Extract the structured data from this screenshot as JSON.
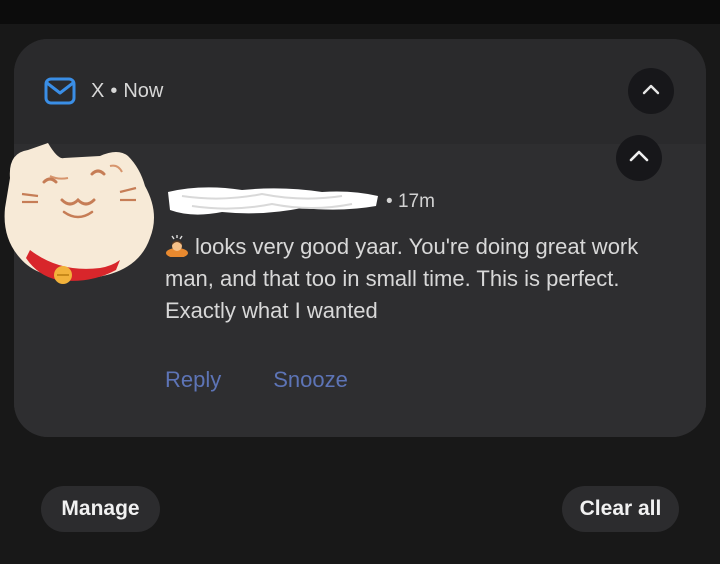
{
  "notification": {
    "app_name": "X",
    "separator": "•",
    "time_header": "Now",
    "sender_time": "17m",
    "message": "looks very good yaar. You're doing great work man, and that too in small time. This is perfect. Exactly what I wanted",
    "actions": {
      "reply": "Reply",
      "snooze": "Snooze"
    }
  },
  "footer": {
    "manage": "Manage",
    "clear_all": "Clear all"
  },
  "icons": {
    "app": "mail-envelope-icon",
    "collapse": "chevron-up-icon",
    "emoji": "person-bowing-emoji"
  },
  "colors": {
    "accent_blue": "#3a8ee6",
    "action_text": "#5d74b6"
  }
}
